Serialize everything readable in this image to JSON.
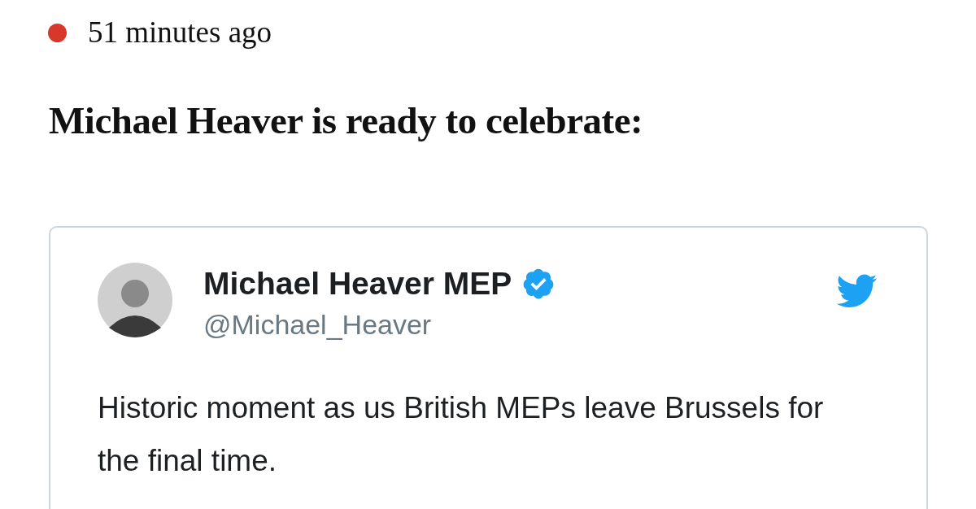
{
  "timestamp": "51 minutes ago",
  "headline": "Michael Heaver is ready to celebrate:",
  "tweet": {
    "author_name": "Michael Heaver MEP",
    "verified": true,
    "handle": "@Michael_Heaver",
    "text": "Historic moment as us British MEPs leave Brussels for the final time."
  }
}
